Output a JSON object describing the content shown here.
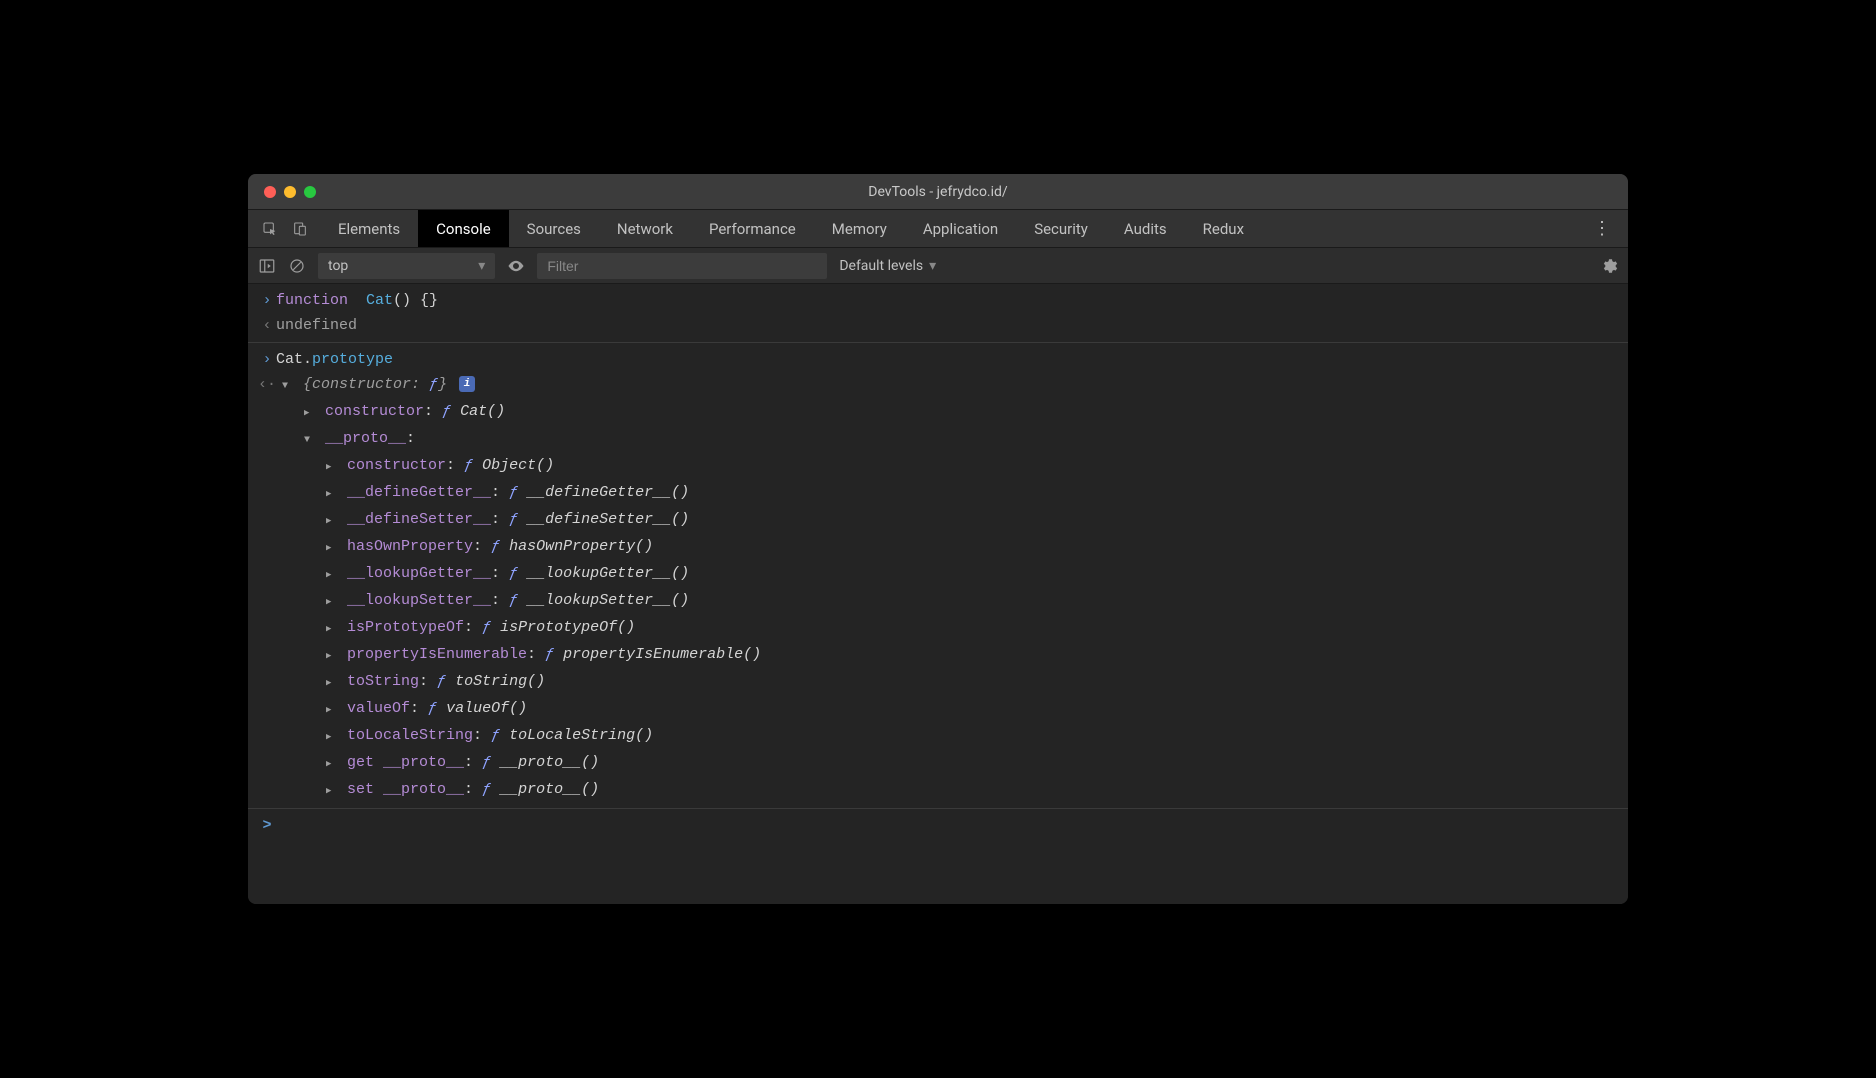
{
  "window": {
    "title": "DevTools - jefrydco.id/",
    "traffic": [
      "red",
      "yellow",
      "green"
    ]
  },
  "tabs": {
    "items": [
      "Elements",
      "Console",
      "Sources",
      "Network",
      "Performance",
      "Memory",
      "Application",
      "Security",
      "Audits",
      "Redux"
    ],
    "active": "Console",
    "more_glyph": "⋮"
  },
  "toolbar": {
    "context": "top",
    "context_caret": "▾",
    "filter_placeholder": "Filter",
    "levels_label": "Default levels",
    "levels_caret": "▾"
  },
  "console": {
    "input1": {
      "kw": "function",
      "name": " Cat",
      "rest": "() {}",
      "sep": " "
    },
    "output1": "undefined",
    "input2": {
      "obj": "Cat",
      "dot": ".",
      "prop": "prototype"
    },
    "result": {
      "summary_open": "{",
      "summary_key": "constructor: ",
      "summary_f": "ƒ",
      "summary_close": "}",
      "info": "i",
      "lvl1": [
        {
          "key": "constructor",
          "val": "Cat()"
        }
      ],
      "proto_label": "__proto__",
      "lvl2": [
        {
          "key": "constructor",
          "val": "Object()"
        },
        {
          "key": "__defineGetter__",
          "val": "__defineGetter__()"
        },
        {
          "key": "__defineSetter__",
          "val": "__defineSetter__()"
        },
        {
          "key": "hasOwnProperty",
          "val": "hasOwnProperty()"
        },
        {
          "key": "__lookupGetter__",
          "val": "__lookupGetter__()"
        },
        {
          "key": "__lookupSetter__",
          "val": "__lookupSetter__()"
        },
        {
          "key": "isPrototypeOf",
          "val": "isPrototypeOf()"
        },
        {
          "key": "propertyIsEnumerable",
          "val": "propertyIsEnumerable()"
        },
        {
          "key": "toString",
          "val": "toString()"
        },
        {
          "key": "valueOf",
          "val": "valueOf()"
        },
        {
          "key": "toLocaleString",
          "val": "toLocaleString()"
        },
        {
          "key": "get __proto__",
          "val": "__proto__()"
        },
        {
          "key": "set __proto__",
          "val": "__proto__()"
        }
      ]
    },
    "prompt": ">"
  }
}
